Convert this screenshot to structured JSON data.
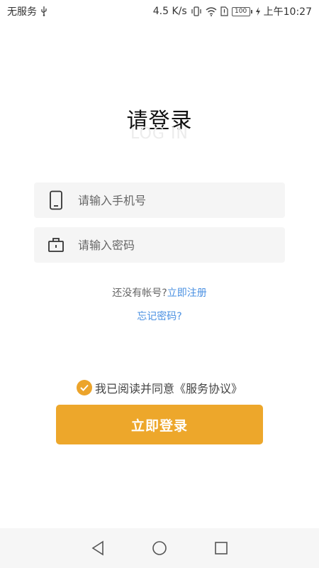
{
  "status_bar": {
    "carrier": "无服务",
    "usb_icon": "usb-icon",
    "speed": "4.5 K/s",
    "battery": "100",
    "time": "上午10:27"
  },
  "title": "请登录",
  "subtitle": "LOG IN",
  "phone_field": {
    "placeholder": "请输入手机号",
    "icon": "phone-icon"
  },
  "password_field": {
    "placeholder": "请输入密码",
    "icon": "lock-icon"
  },
  "register": {
    "prompt": "还没有帐号?",
    "link": "立即注册"
  },
  "forgot_link": "忘记密码?",
  "agreement": {
    "text": "我已阅读并同意《服务协议》",
    "checked": true
  },
  "login_button": "立即登录",
  "colors": {
    "accent": "#EDA72B",
    "link": "#4A90E2"
  },
  "nav_bar": {
    "back": "back-icon",
    "home": "home-icon",
    "recents": "recents-icon"
  }
}
